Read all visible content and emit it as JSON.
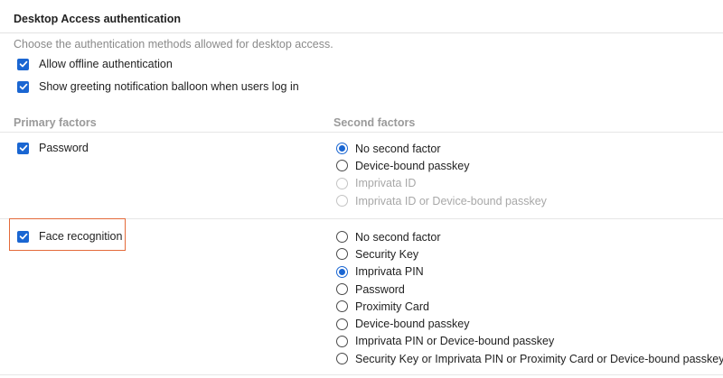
{
  "section": {
    "title": "Desktop Access authentication",
    "description": "Choose the authentication methods allowed for desktop access."
  },
  "options": {
    "offline": {
      "label": "Allow offline authentication",
      "checked": true
    },
    "greeting": {
      "label": "Show greeting notification balloon when users log in",
      "checked": true
    }
  },
  "columns": {
    "primary": "Primary factors",
    "second": "Second factors"
  },
  "factors": [
    {
      "label": "Password",
      "checked": true,
      "second_factors": [
        {
          "label": "No second factor",
          "selected": true,
          "disabled": false
        },
        {
          "label": "Device-bound passkey",
          "selected": false,
          "disabled": false
        },
        {
          "label": "Imprivata ID",
          "selected": false,
          "disabled": true
        },
        {
          "label": "Imprivata ID or Device-bound passkey",
          "selected": false,
          "disabled": true
        }
      ]
    },
    {
      "label": "Face recognition",
      "checked": true,
      "highlighted": true,
      "second_factors": [
        {
          "label": "No second factor",
          "selected": false,
          "disabled": false
        },
        {
          "label": "Security Key",
          "selected": false,
          "disabled": false
        },
        {
          "label": "Imprivata PIN",
          "selected": true,
          "disabled": false
        },
        {
          "label": "Password",
          "selected": false,
          "disabled": false
        },
        {
          "label": "Proximity Card",
          "selected": false,
          "disabled": false
        },
        {
          "label": "Device-bound passkey",
          "selected": false,
          "disabled": false
        },
        {
          "label": "Imprivata PIN or Device-bound passkey",
          "selected": false,
          "disabled": false
        },
        {
          "label": "Security Key or Imprivata PIN or Proximity Card or Device-bound passkey",
          "selected": false,
          "disabled": false
        }
      ]
    }
  ],
  "colors": {
    "accent": "#1a66d2",
    "highlight": "#e46a3a"
  }
}
